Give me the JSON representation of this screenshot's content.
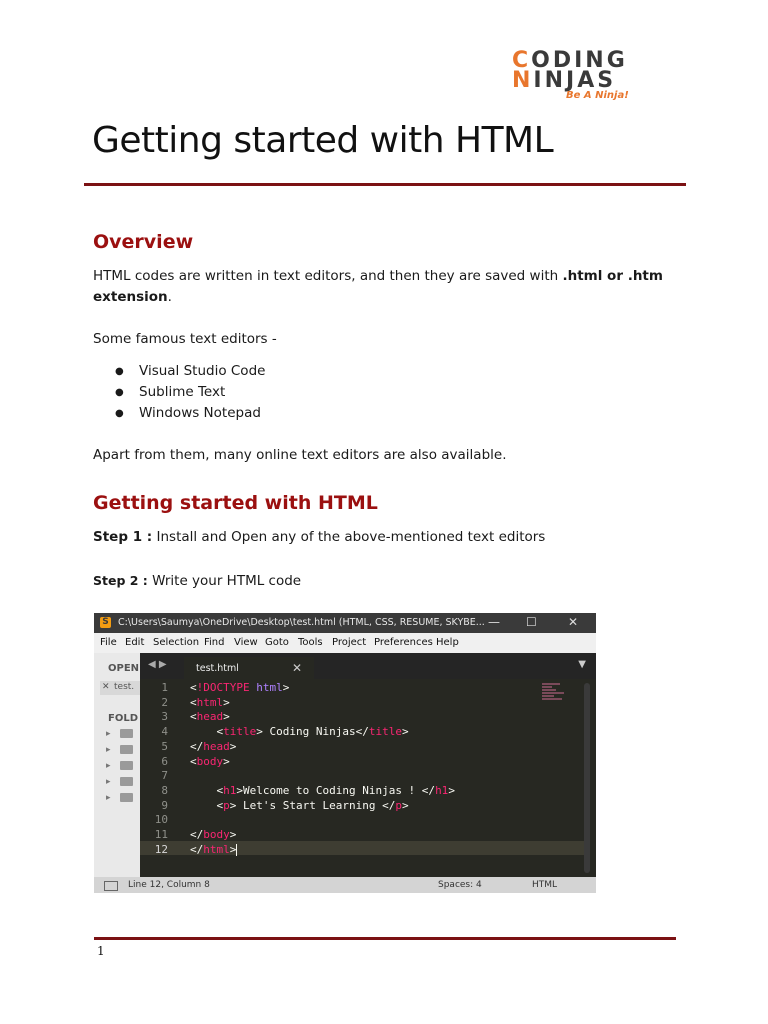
{
  "logo": {
    "row1_a": "C",
    "row1_b": "ODING",
    "row2_a": "N",
    "row2_b": "INJAS",
    "tagline": "Be A Ninja!"
  },
  "title": "Getting started with HTML",
  "overview": {
    "heading": "Overview",
    "para1_text": "HTML codes are written in text editors, and then they are saved with ",
    "para1_bold": ".html or .htm extension",
    "para1_end": ".",
    "para2": "Some famous text editors -",
    "editors": [
      "Visual Studio Code",
      "Sublime Text",
      "Windows Notepad"
    ],
    "para3": "Apart from them, many online text editors are also available."
  },
  "getting_started": {
    "heading": "Getting started with HTML",
    "step1_label": "Step 1 :",
    "step1_text": " Install and Open any of the above-mentioned text editors",
    "step2_label": "Step 2 :",
    "step2_text": " Write your HTML code"
  },
  "editor": {
    "window_title": "C:\\Users\\Saumya\\OneDrive\\Desktop\\test.html (HTML, CSS, RESUME, SKYBE...",
    "menu": [
      "File",
      "Edit",
      "Selection",
      "Find",
      "View",
      "Goto",
      "Tools",
      "Project",
      "Preferences",
      "Help"
    ],
    "sidebar_open": "OPEN",
    "sidebar_file": "test.",
    "sidebar_folders": "FOLD",
    "tab_name": "test.html",
    "line_numbers": [
      "1",
      "2",
      "3",
      "4",
      "5",
      "6",
      "7",
      "8",
      "9",
      "10",
      "11",
      "12"
    ],
    "status_position": "Line 12, Column 8",
    "status_spaces": "Spaces: 4",
    "status_syntax": "HTML"
  },
  "page_number": "1",
  "colors": {
    "heading": "#9b1010",
    "rule": "#7b1113",
    "logo_orange": "#e8762d"
  }
}
